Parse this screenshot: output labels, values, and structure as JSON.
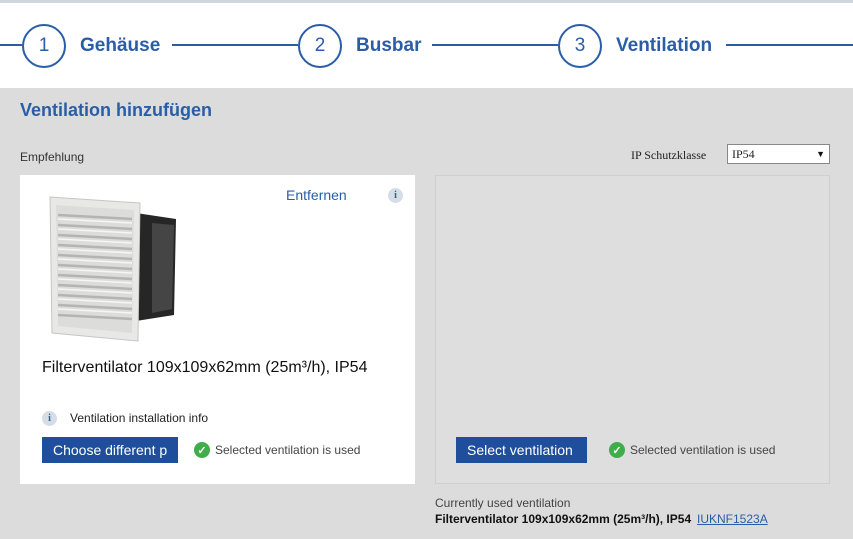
{
  "stepper": {
    "steps": [
      {
        "number": "1",
        "label": "Gehäuse"
      },
      {
        "number": "2",
        "label": "Busbar"
      },
      {
        "number": "3",
        "label": "Ventilation"
      }
    ]
  },
  "section": {
    "title": "Ventilation hinzufügen",
    "recommendation_label": "Empfehlung",
    "ip_label": "IP Schutzklasse",
    "ip_value": "IP54"
  },
  "recommendation_card": {
    "remove_label": "Entfernen",
    "product_name": "Filterventilator 109x109x62mm (25m³/h), IP54",
    "install_info": "Ventilation installation info",
    "choose_button": "Choose different p",
    "status": "Selected ventilation is used"
  },
  "selection_panel": {
    "select_button": "Select ventilation",
    "status": "Selected ventilation is used"
  },
  "current": {
    "label": "Currently used ventilation",
    "value": "Filterventilator 109x109x62mm (25m³/h), IP54",
    "code": "IUKNF1523A"
  },
  "colors": {
    "accent": "#2a5da8",
    "button": "#1f4f9c",
    "success": "#3fae4a"
  }
}
